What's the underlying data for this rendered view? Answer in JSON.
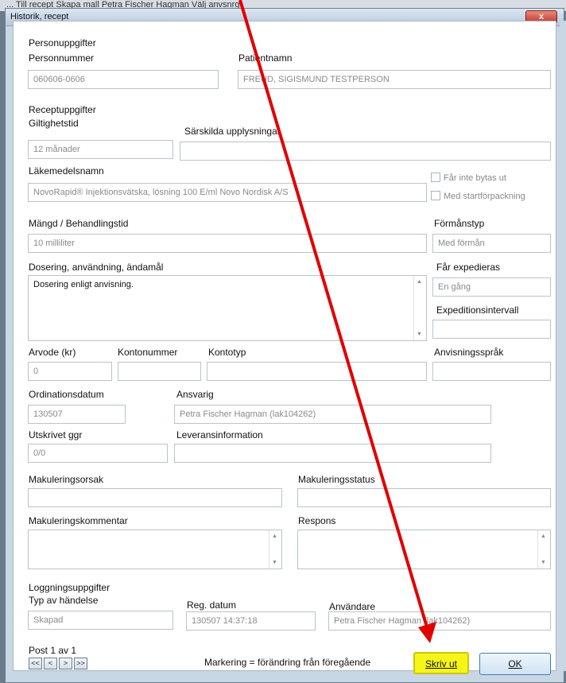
{
  "background": {
    "strip_text": "...  Till recept      Skapa mall   Petra Fischer Hagman     Välj anvsnrg"
  },
  "window": {
    "title": "Historik, recept",
    "close_label": "x"
  },
  "person": {
    "section": "Personuppgifter",
    "personnummer_label": "Personnummer",
    "personnummer": "060606-0606",
    "patientnamn_label": "Patientnamn",
    "patientnamn": "FREUD, SIGISMUND TESTPERSON"
  },
  "recept": {
    "section": "Receptuppgifter",
    "giltighetstid_label": "Giltighetstid",
    "giltighetstid": "12 månader",
    "sarskilda_label": "Särskilda upplysningar",
    "sarskilda": "",
    "lakemedel_label": "Läkemedelsnamn",
    "lakemedel": "NovoRapid® Injektionsvätska, lösning 100 E/ml Novo Nordisk A/S",
    "far_inte_bytas": "Får inte bytas ut",
    "startforpackning": "Med startförpackning",
    "mangd_label": "Mängd / Behandlingstid",
    "mangd": "10 milliliter",
    "formanstyp_label": "Förmånstyp",
    "formanstyp": "Med förmån",
    "dosering_label": "Dosering, användning, ändamål",
    "dosering": "Dosering enligt anvisning.",
    "far_expedieras_label": "Får expedieras",
    "far_expedieras": "En gång",
    "expeditionsintervall_label": "Expeditionsintervall",
    "expeditionsintervall": "",
    "arvode_label": "Arvode (kr)",
    "arvode": "0",
    "kontonummer_label": "Kontonummer",
    "kontonummer": "",
    "kontotyp_label": "Kontotyp",
    "kontotyp": "",
    "anvisningssprak_label": "Anvisningsspråk",
    "anvisningssprak": "",
    "ordinationsdatum_label": "Ordinationsdatum",
    "ordinationsdatum": "130507",
    "ansvarig_label": "Ansvarig",
    "ansvarig": "Petra Fischer Hagman (lak104262)",
    "utskrivet_label": "Utskrivet ggr",
    "utskrivet": "0/0",
    "leverans_label": "Leveransinformation",
    "leverans": ""
  },
  "makulering": {
    "orsak_label": "Makuleringsorsak",
    "orsak": "",
    "status_label": "Makuleringsstatus",
    "status": "",
    "kommentar_label": "Makuleringskommentar",
    "kommentar": "",
    "respons_label": "Respons",
    "respons": ""
  },
  "loggning": {
    "section": "Loggningsuppgifter",
    "typ_label": "Typ av händelse",
    "typ": "Skapad",
    "regdatum_label": "Reg. datum",
    "regdatum": "130507 14:37:18",
    "anvandare_label": "Användare",
    "anvandare": "Petra Fischer Hagman (lak104262)"
  },
  "footer": {
    "post_label": "Post  1 av 1",
    "nav": [
      "<<",
      "<",
      ">",
      ">>"
    ],
    "markering": "Markering = förändring från föregående",
    "print_label": "Skriv ut",
    "ok_label": "OK"
  },
  "colors": {
    "annotation_arrow": "#e00000",
    "print_highlight": "#f5f51a"
  }
}
